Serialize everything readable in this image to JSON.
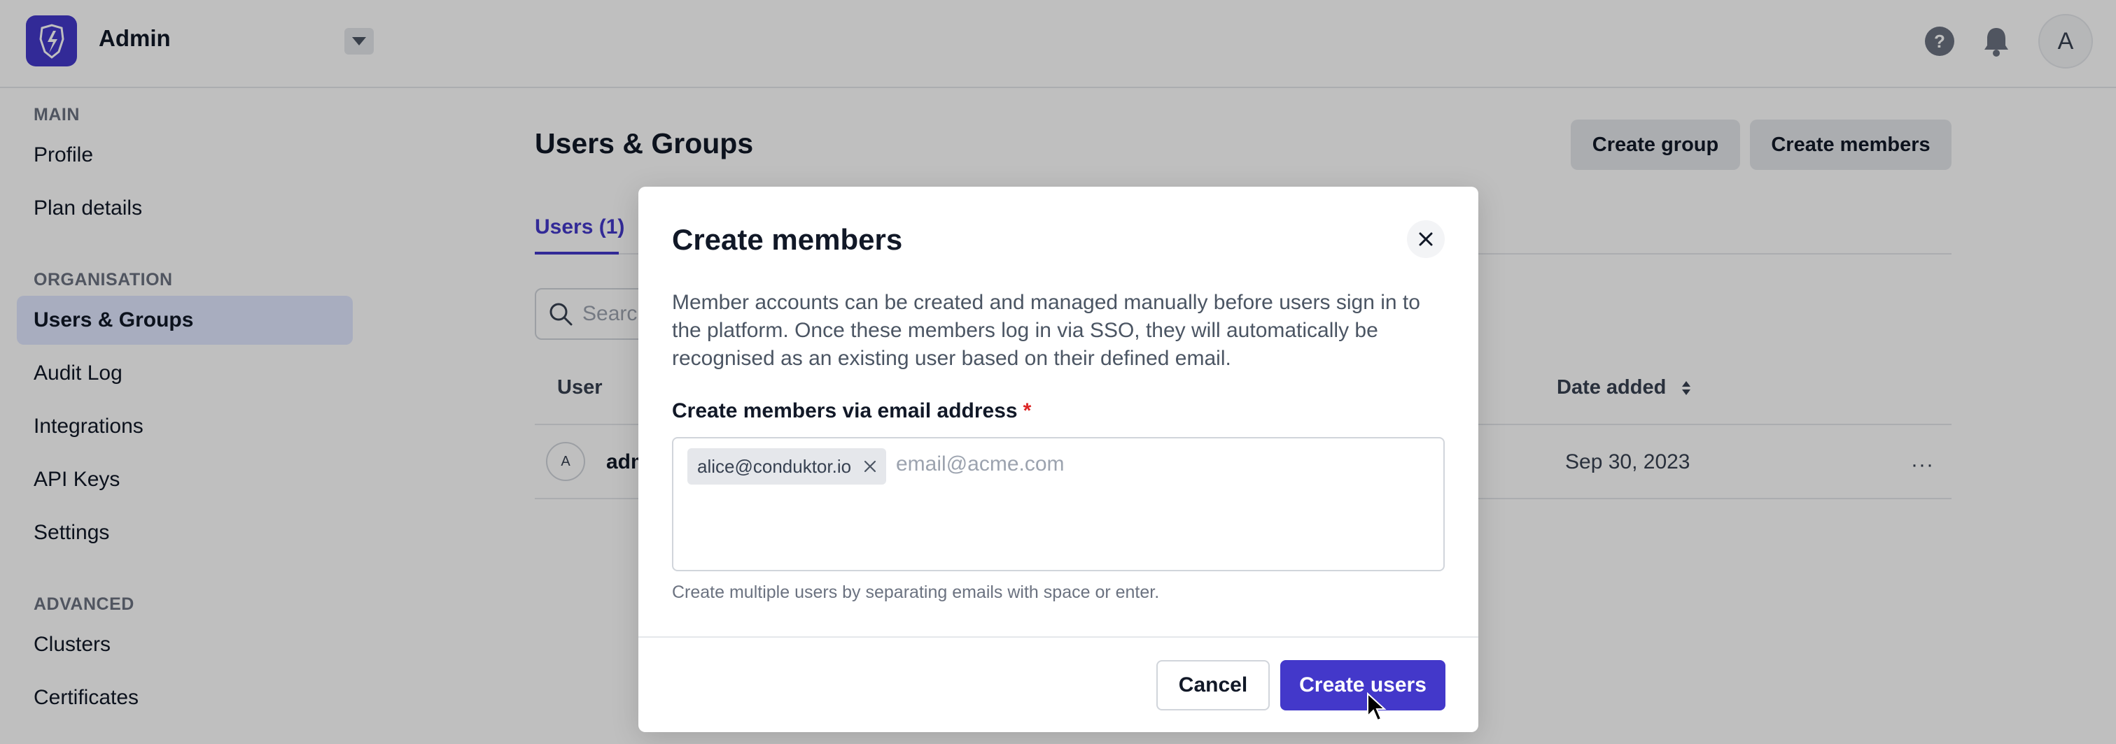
{
  "app": {
    "brand": "Admin"
  },
  "header": {
    "help_icon": "help-circle-icon",
    "help_glyph": "?",
    "notifications_icon": "bell-icon",
    "avatar_initial": "A"
  },
  "sidebar": {
    "sections": [
      {
        "title": "MAIN",
        "items": [
          "Profile",
          "Plan details"
        ]
      },
      {
        "title": "ORGANISATION",
        "items": [
          "Users & Groups",
          "Audit Log",
          "Integrations",
          "API Keys",
          "Settings"
        ]
      },
      {
        "title": "ADVANCED",
        "items": [
          "Clusters",
          "Certificates"
        ]
      }
    ],
    "active_item": "Users & Groups"
  },
  "main": {
    "title": "Users & Groups",
    "actions": {
      "create_group": "Create group",
      "create_members": "Create members"
    },
    "tabs": [
      {
        "label": "Users (1)",
        "active": true
      }
    ],
    "search": {
      "placeholder": "Search"
    },
    "table": {
      "columns": {
        "user": "User",
        "date_added": "Date added"
      },
      "rows": [
        {
          "avatar_initial": "A",
          "user": "adm",
          "date_added": "Sep 30, 2023",
          "more": "···"
        }
      ]
    }
  },
  "modal": {
    "title": "Create members",
    "description": "Member accounts can be created and managed manually before users sign in to the platform. Once these members log in via SSO, they will automatically be recognised as an existing user based on their defined email.",
    "field_label": "Create members via email address",
    "required_mark": "*",
    "chips": [
      "alice@conduktor.io"
    ],
    "input_placeholder": "email@acme.com",
    "helper": "Create multiple users by separating emails with space or enter.",
    "cancel_label": "Cancel",
    "submit_label": "Create users"
  },
  "colors": {
    "accent": "#4338ca",
    "active_nav_bg": "#e0e7ff",
    "required": "#dc2626",
    "overlay": "rgba(0,0,0,0.25)"
  }
}
